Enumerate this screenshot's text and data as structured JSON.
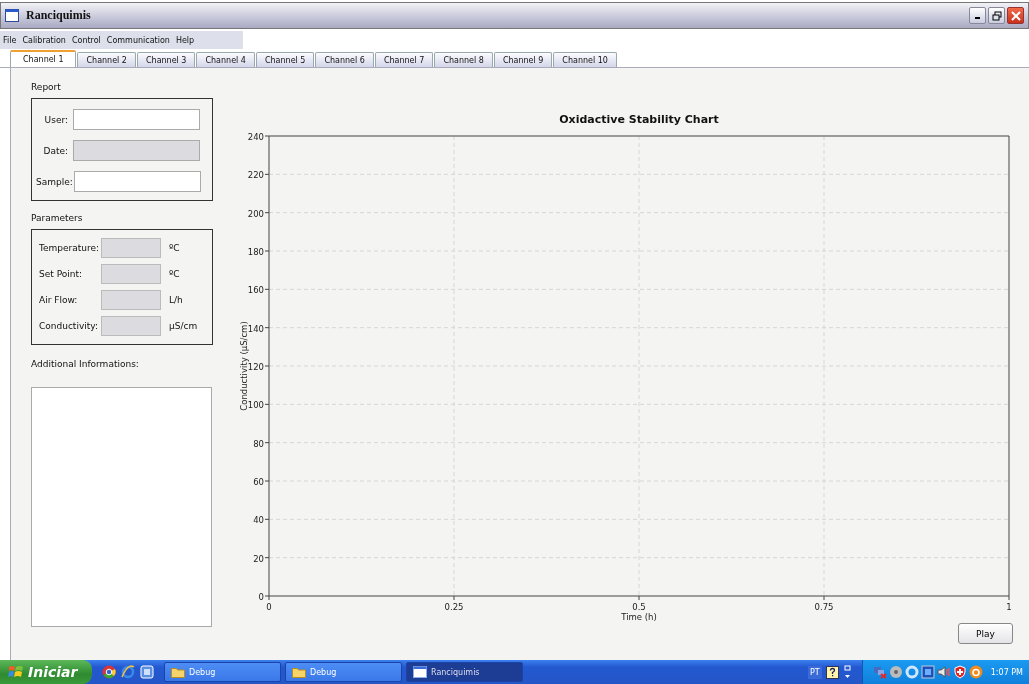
{
  "window": {
    "title": "Ranciquimis"
  },
  "menu": [
    "File",
    "Calibration",
    "Control",
    "Communication",
    "Help"
  ],
  "tabs": [
    {
      "label": "Channel 1",
      "selected": true
    },
    {
      "label": "Channel 2",
      "selected": false
    },
    {
      "label": "Channel 3",
      "selected": false
    },
    {
      "label": "Channel 4",
      "selected": false
    },
    {
      "label": "Channel 5",
      "selected": false
    },
    {
      "label": "Channel 6",
      "selected": false
    },
    {
      "label": "Channel 7",
      "selected": false
    },
    {
      "label": "Channel 8",
      "selected": false
    },
    {
      "label": "Channel 9",
      "selected": false
    },
    {
      "label": "Channel 10",
      "selected": false
    }
  ],
  "report": {
    "title": "Report",
    "fields": [
      {
        "label": "User:",
        "disabled": false
      },
      {
        "label": "Date:",
        "disabled": true
      },
      {
        "label": "Sample:",
        "disabled": false
      }
    ]
  },
  "parameters": {
    "title": "Parameters",
    "fields": [
      {
        "label": "Temperature:",
        "unit": "ºC"
      },
      {
        "label": "Set Point:",
        "unit": "ºC"
      },
      {
        "label": "Air Flow:",
        "unit": "L/h"
      },
      {
        "label": "Conductivity:",
        "unit": "µS/cm"
      }
    ]
  },
  "additional": {
    "label": "Additional Informations:"
  },
  "chart_data": {
    "type": "line",
    "title": "Oxidactive Stability Chart",
    "xlabel": "Time (h)",
    "ylabel": "Conductivity (µS/cm)",
    "grid": true,
    "xlim": [
      0,
      1
    ],
    "ylim": [
      0,
      240
    ],
    "xticks": [
      0,
      0.25,
      0.5,
      0.75,
      1
    ],
    "yticks": [
      0,
      20,
      40,
      60,
      80,
      100,
      120,
      140,
      160,
      180,
      200,
      220,
      240
    ]
  },
  "play_button": "Play",
  "taskbar": {
    "start": "Iniciar",
    "tasks": [
      {
        "label": "Debug",
        "selected": false,
        "kind": "folder"
      },
      {
        "label": "Debug",
        "selected": false,
        "kind": "folder"
      },
      {
        "label": "Ranciquimis",
        "selected": true,
        "kind": "window"
      }
    ],
    "language": "PT",
    "clock": "1:07 PM"
  }
}
